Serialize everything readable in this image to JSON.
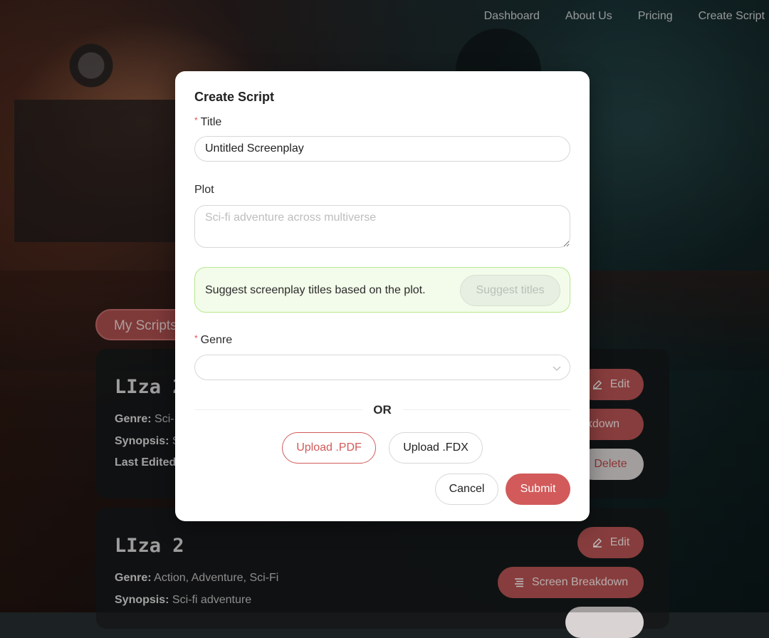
{
  "nav": {
    "items": [
      "Dashboard",
      "About Us",
      "Pricing",
      "Create Script"
    ]
  },
  "background": {
    "my_scripts_tab": "My Scripts",
    "cards": [
      {
        "title": "LIza 2",
        "genre_label": "Genre:",
        "genre_value": "Sci-",
        "synopsis_label": "Synopsis:",
        "synopsis_value": "S",
        "last_edited_label": "Last Edited",
        "edit_button": "Edit",
        "breakdown_button": "akdown",
        "delete_button": "Delete"
      },
      {
        "title": "LIza 2",
        "genre_label": "Genre:",
        "genre_value": "Action, Adventure, Sci-Fi",
        "synopsis_label": "Synopsis:",
        "synopsis_value": "Sci-fi adventure",
        "edit_button": "Edit",
        "breakdown_button": "Screen Breakdown"
      }
    ]
  },
  "modal": {
    "title": "Create Script",
    "title_field": {
      "label": "Title",
      "required_mark": "*",
      "value": "Untitled Screenplay"
    },
    "plot_field": {
      "label": "Plot",
      "placeholder": "Sci-fi adventure across multiverse"
    },
    "suggest": {
      "text": "Suggest screenplay titles based on the plot.",
      "button": "Suggest titles"
    },
    "genre_field": {
      "label": "Genre",
      "required_mark": "*",
      "value": ""
    },
    "or_text": "OR",
    "upload_pdf": "Upload .PDF",
    "upload_fdx": "Upload .FDX",
    "cancel": "Cancel",
    "submit": "Submit"
  },
  "colors": {
    "accent": "#d25a5a",
    "suggest_bg": "#f3fcea",
    "suggest_border": "#b8e68f"
  }
}
